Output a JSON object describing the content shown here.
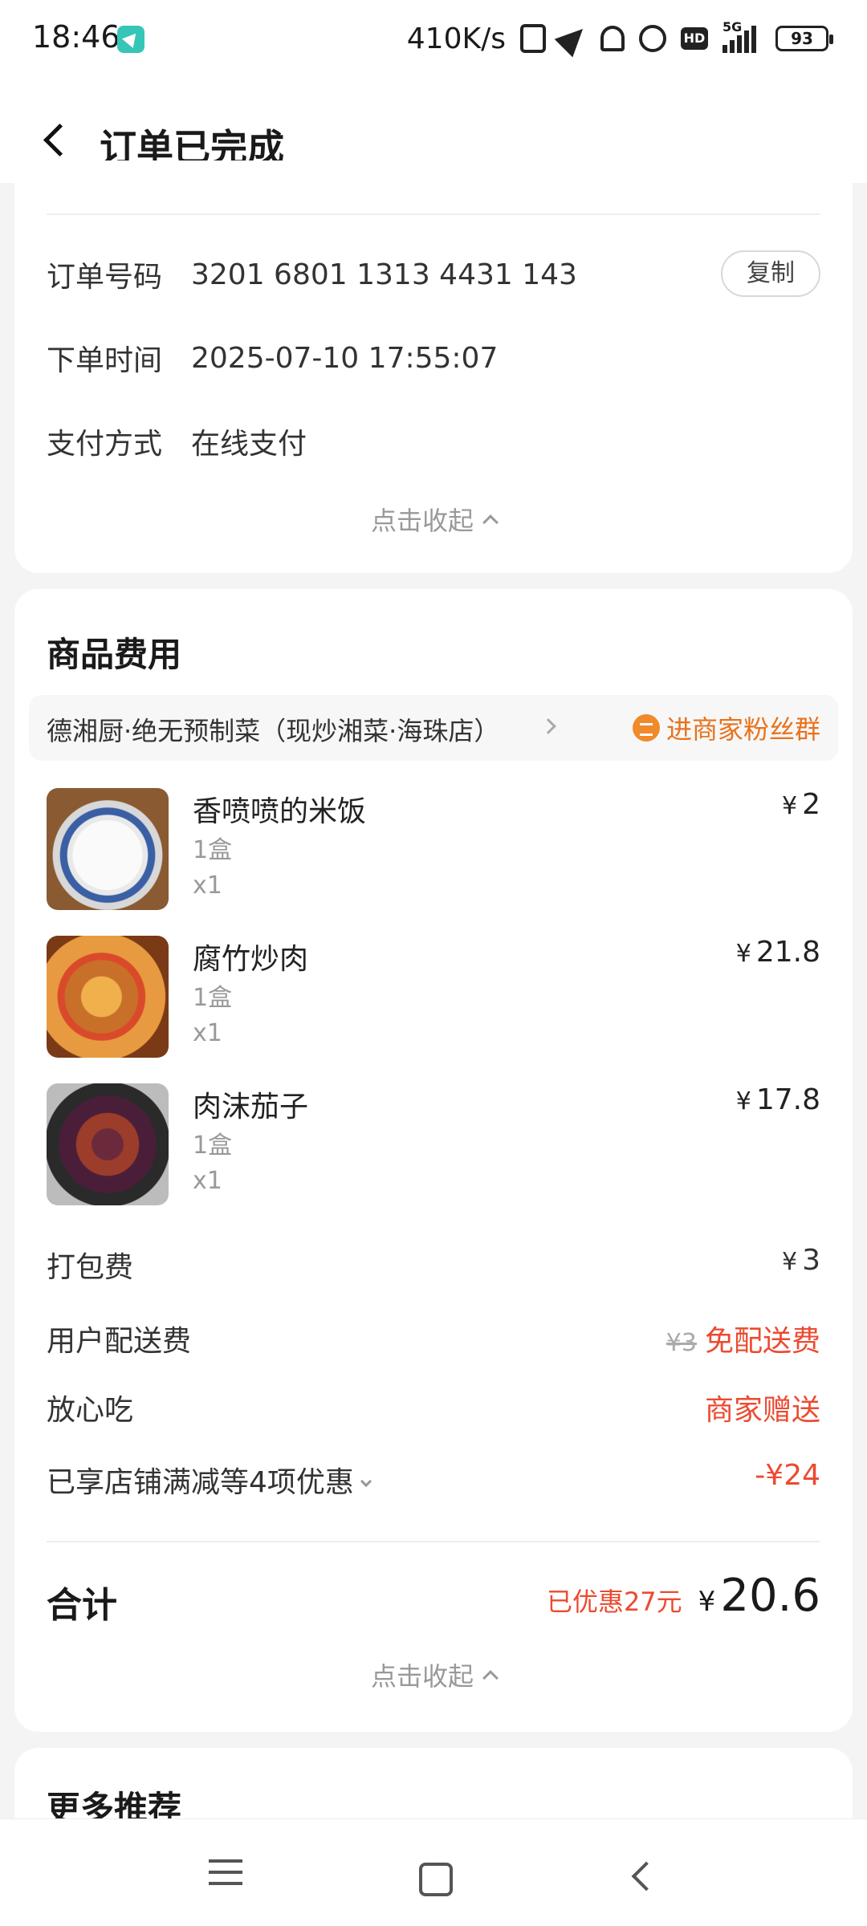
{
  "status_bar": {
    "time": "18:46",
    "net_speed": "410K/s",
    "hd_label": "HD",
    "network": "5G",
    "battery": "93"
  },
  "header": {
    "title": "订单已完成"
  },
  "order_info": {
    "order_no_label": "订单号码",
    "order_no_value": "3201 6801 1313 4431 143",
    "copy_label": "复制",
    "order_time_label": "下单时间",
    "order_time_value": "2025-07-10 17:55:07",
    "pay_label": "支付方式",
    "pay_value": "在线支付",
    "collapse_label": "点击收起"
  },
  "fees": {
    "title": "商品费用",
    "store_name": "德湘厨·绝无预制菜（现炒湘菜·海珠店）",
    "fan_group": "进商家粉丝群",
    "currency": "¥",
    "items": [
      {
        "name": "香喷喷的米饭",
        "spec": "1盒",
        "qty": "x1",
        "price": "2"
      },
      {
        "name": "腐竹炒肉",
        "spec": "1盒",
        "qty": "x1",
        "price": "21.8"
      },
      {
        "name": "肉沫茄子",
        "spec": "1盒",
        "qty": "x1",
        "price": "17.8"
      }
    ],
    "packing_label": "打包费",
    "packing_value": "3",
    "delivery_label": "用户配送费",
    "delivery_original": "¥3",
    "delivery_value": "免配送费",
    "assurance_label": "放心吃",
    "assurance_value": "商家赠送",
    "discount_label": "已享店铺满减等4项优惠",
    "discount_value": "-¥24",
    "total_label": "合计",
    "saved_text": "已优惠27元",
    "total_value": "20.6",
    "collapse_label": "点击收起"
  },
  "more": {
    "title": "更多推荐"
  },
  "colors": {
    "accent_red": "#ec4a30",
    "accent_orange": "#e8721c"
  },
  "icons": {
    "back": "back-arrow-icon",
    "fan": "chat-bubble-icon",
    "nav": [
      "menu-icon",
      "home-icon",
      "back-icon"
    ]
  }
}
